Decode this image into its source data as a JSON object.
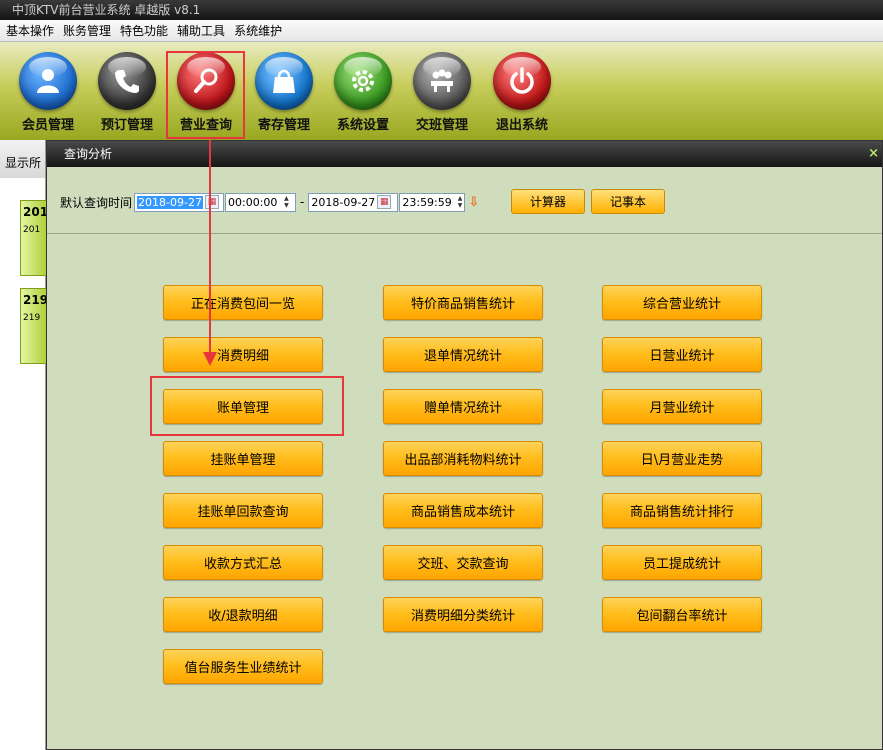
{
  "window": {
    "title": "中顶KTV前台营业系统 卓越版 v8.1"
  },
  "menubar": [
    "基本操作",
    "账务管理",
    "特色功能",
    "辅助工具",
    "系统维护"
  ],
  "toolbar": [
    {
      "label": "会员管理",
      "icon": "member-icon",
      "color": "#1f6fd1"
    },
    {
      "label": "预订管理",
      "icon": "phone-icon",
      "color": "#3a3a3a"
    },
    {
      "label": "营业查询",
      "icon": "magnifier-icon",
      "color": "#c0171c"
    },
    {
      "label": "寄存管理",
      "icon": "bag-icon",
      "color": "#1676cf"
    },
    {
      "label": "系统设置",
      "icon": "gear-icon",
      "color": "#3a9a22"
    },
    {
      "label": "交班管理",
      "icon": "meeting-icon",
      "color": "#5a5a5a"
    },
    {
      "label": "退出系统",
      "icon": "power-icon",
      "color": "#c41a1a"
    }
  ],
  "left_panel": {
    "header": "显示所",
    "rooms": [
      {
        "no": "201",
        "sub": "201"
      },
      {
        "no": "219",
        "sub": "219"
      }
    ]
  },
  "dialog": {
    "title": "查询分析",
    "close": "×",
    "query_label": "默认查询时间",
    "start_date": "2018-09-27",
    "start_time": "00:00:00",
    "separator": "-",
    "end_date": "2018-09-27",
    "end_time": "23:59:59",
    "calculator_label": "计算器",
    "notepad_label": "记事本"
  },
  "columns": [
    [
      "正在消费包间一览",
      "消费明细",
      "账单管理",
      "挂账单管理",
      "挂账单回款查询",
      "收款方式汇总",
      "收/退款明细",
      "值台服务生业绩统计"
    ],
    [
      "特价商品销售统计",
      "退单情况统计",
      "赠单情况统计",
      "出品部消耗物料统计",
      "商品销售成本统计",
      "交班、交款查询",
      "消费明细分类统计"
    ],
    [
      "综合营业统计",
      "日营业统计",
      "月营业统计",
      "日\\月营业走势",
      "商品销售统计排行",
      "员工提成统计",
      "包间翻台率统计"
    ]
  ],
  "colors": {
    "highlight": "#e8373c",
    "button": "#ffb000",
    "dialog_bg": "#cfddbd"
  }
}
